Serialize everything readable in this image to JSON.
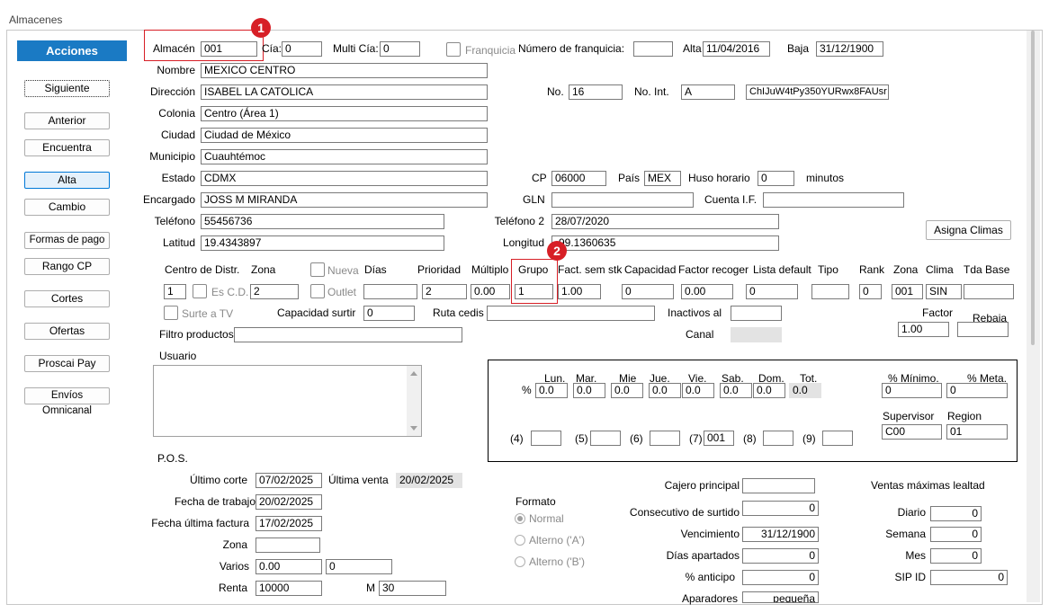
{
  "window": {
    "title": "Almacenes"
  },
  "sidebar": {
    "header": "Acciones",
    "buttons": [
      "Siguiente",
      "Anterior",
      "Encuentra",
      "Alta",
      "Cambio",
      "Formas de pago",
      "Rango CP",
      "Cortes",
      "Ofertas",
      "Proscai Pay",
      "Envíos Omnicanal"
    ]
  },
  "badges": {
    "one": "1",
    "two": "2"
  },
  "top": {
    "almacen_label": "Almacén",
    "almacen": "001",
    "cia_label": "Cía:",
    "cia": "0",
    "multi_cia_label": "Multi Cía:",
    "multi_cia": "0",
    "franquicia_label": "Franquicia",
    "num_franquicia_label": "Número de franquicia:",
    "num_franquicia": "",
    "alta_label": "Alta",
    "alta": "11/04/2016",
    "baja_label": "Baja",
    "baja": "31/12/1900"
  },
  "general": {
    "nombre_label": "Nombre",
    "nombre": "MEXICO CENTRO",
    "direccion_label": "Dirección",
    "direccion": "ISABEL LA CATOLICA",
    "no_label": "No.",
    "no": "16",
    "no_int_label": "No. Int.",
    "no_int": "A",
    "code": "ChIJuW4tPy350YURwx8FAUsr",
    "colonia_label": "Colonia",
    "colonia": "Centro (Área 1)",
    "ciudad_label": "Ciudad",
    "ciudad": "Ciudad de México",
    "municipio_label": "Municipio",
    "municipio": "Cuauhtémoc",
    "estado_label": "Estado",
    "estado": "CDMX",
    "cp_label": "CP",
    "cp": "06000",
    "pais_label": "País",
    "pais": "MEX",
    "huso_label": "Huso horario",
    "huso": "0",
    "minutos_label": "minutos",
    "encargado_label": "Encargado",
    "encargado": "JOSS M MIRANDA",
    "gln_label": "GLN",
    "gln": "",
    "cuenta_label": "Cuenta I.F.",
    "cuenta": "",
    "telefono_label": "Teléfono",
    "telefono": "55456736",
    "telefono2_label": "Teléfono 2",
    "telefono2": "28/07/2020",
    "asigna_climas": "Asigna Climas",
    "latitud_label": "Latitud",
    "latitud": "19.4343897",
    "longitud_label": "Longitud",
    "longitud": "-99.1360635"
  },
  "dist": {
    "centro_label": "Centro de Distr.",
    "centro": "1",
    "es_cd_label": "Es C.D.",
    "zona_label": "Zona",
    "zona": "2",
    "nueva_label": "Nueva",
    "outlet_label": "Outlet",
    "dias_label": "Días",
    "dias": "",
    "prioridad_label": "Prioridad",
    "prioridad": "2",
    "multiplo_label": "Múltiplo",
    "multiplo": "0.00",
    "grupo_label": "Grupo",
    "grupo": "1",
    "fact_label": "Fact. sem stk",
    "fact": "1.00",
    "capacidad_label": "Capacidad",
    "capacidad": "0",
    "factor_recoger_label": "Factor recoger",
    "factor_recoger": "0.00",
    "lista_label": "Lista default",
    "lista": "0",
    "tipo_label": "Tipo",
    "tipo": "",
    "rank_label": "Rank",
    "rank": "0",
    "zona2_label": "Zona",
    "zona2": "001",
    "clima_label": "Clima",
    "clima": "SIN",
    "tda_label": "Tda Base",
    "tda": "",
    "surte_label": "Surte a TV",
    "cap_surtir_label": "Capacidad surtir",
    "cap_surtir": "0",
    "ruta_label": "Ruta cedis",
    "ruta": "",
    "inactivos_label": "Inactivos al",
    "inactivos": "",
    "factor_label": "Factor",
    "factor": "1.00",
    "rebaja_label": "Rebaja",
    "rebaja": "",
    "filtro_label": "Filtro productos",
    "filtro": "",
    "canal_label": "Canal",
    "usuario_label": "Usuario"
  },
  "week": {
    "pct": "%",
    "days": [
      "Lun.",
      "Mar.",
      "Mie",
      "Jue.",
      "Vie.",
      "Sab.",
      "Dom.",
      "Tot."
    ],
    "values": [
      "0.0",
      "0.0",
      "0.0",
      "0.0",
      "0.0",
      "0.0",
      "0.0",
      "0.0"
    ],
    "pct_min_label": "% Mínimo.",
    "pct_min": "0",
    "pct_meta_label": "% Meta.",
    "pct_meta": "0",
    "supervisor_label": "Supervisor",
    "supervisor": "C00",
    "region_label": "Region",
    "region": "01",
    "slots": [
      {
        "label": "(4)",
        "value": ""
      },
      {
        "label": "(5)",
        "value": ""
      },
      {
        "label": "(6)",
        "value": ""
      },
      {
        "label": "(7)",
        "value": "001"
      },
      {
        "label": "(8)",
        "value": ""
      },
      {
        "label": "(9)",
        "value": ""
      }
    ]
  },
  "pos": {
    "title": "P.O.S.",
    "ultimo_corte_label": "Último corte",
    "ultimo_corte": "07/02/2025",
    "ultima_venta_label": "Última venta",
    "ultima_venta": "20/02/2025",
    "fecha_trabajo_label": "Fecha de trabajo",
    "fecha_trabajo": "20/02/2025",
    "fecha_factura_label": "Fecha última factura",
    "fecha_factura": "17/02/2025",
    "zona_label": "Zona",
    "zona": "",
    "varios_label": "Varios",
    "varios1": "0.00",
    "varios2": "0",
    "renta_label": "Renta",
    "renta": "10000",
    "m_label": "M",
    "m": "30",
    "formato_label": "Formato",
    "formatos": [
      "Normal",
      "Alterno ('A')",
      "Alterno ('B')"
    ],
    "cajero_label": "Cajero principal",
    "cajero": "",
    "consecutivo_label": "Consecutivo de surtido",
    "consecutivo": "0",
    "vencimiento_label": "Vencimiento",
    "vencimiento": "31/12/1900",
    "dias_apartados_label": "Días apartados",
    "dias_apartados": "0",
    "anticipo_label": "% anticipo",
    "anticipo": "0",
    "aparadores_label": "Aparadores",
    "aparadores": "pequeña",
    "ventas_label": "Ventas máximas lealtad",
    "diario_label": "Diario",
    "diario": "0",
    "semana_label": "Semana",
    "semana": "0",
    "mes_label": "Mes",
    "mes": "0",
    "sip_label": "SIP ID",
    "sip": "0"
  }
}
